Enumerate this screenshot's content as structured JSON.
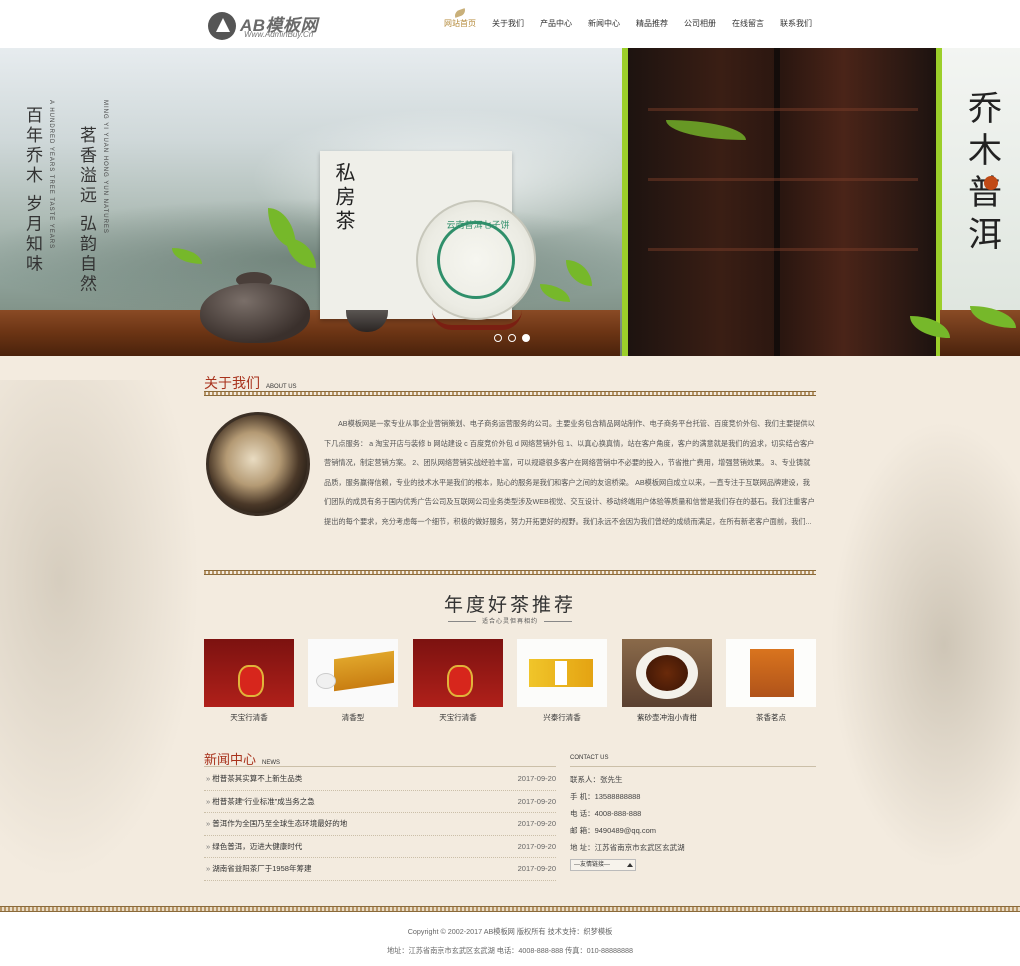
{
  "logo": {
    "text": "AB模板网",
    "sub": "Www.AdminBuy.Cn"
  },
  "nav": [
    "网站首页",
    "关于我们",
    "产品中心",
    "新闻中心",
    "精品推荐",
    "公司相册",
    "在线留言",
    "联系我们"
  ],
  "banner": {
    "vert1": "百年乔木 岁月知味",
    "vert2": "茗香溢远 弘韵自然",
    "en1": "A HUNDRED YEARS TREE TASTE YEARS",
    "en2": "MING YI YUAN HONG YUN NATURES",
    "card_title": "私房茶",
    "cake_label": "云南普洱七子饼",
    "right_title": "乔木普洱",
    "slides": 3,
    "active_slide": 3
  },
  "about": {
    "title": "关于我们",
    "en": "ABOUT US",
    "text": "AB模板网是一家专业从事企业营销策划、电子商务运营服务的公司。主要业务包含精品网站制作、电子商务平台托管、百度竞价外包、我们主要提供以下几点服务： a 淘宝开店与装修 b 网站建设 c 百度竞价外包 d 网络营销外包 1、以真心换真情，站在客户角度，客户的满意就是我们的追求，切实结合客户营销情况，制定营销方案。 2、团队网络营销实战经验丰富，可以规避很多客户在网络营销中不必要的投入，节省推广费用，增强营销效果。 3、专业铸就品质，服务赢得信赖，专业的技术水平是我们的根本，贴心的服务是我们和客户之间的友谊桥梁。 AB模板网自成立以来，一直专注于互联网品牌建设，我们团队的成员有务于国内优秀广告公司及互联网公司业务类型涉及WEB视觉、交互设计、移动终端用户体验等质量和信誉是我们存在的基石。我们注重客户提出的每个要求，充分考虑每一个细节，积极的做好服务，努力开拓更好的视野。我们永远不会因为我们曾经的成绩而满足，在所有新老客户面前，我们..."
  },
  "tea": {
    "title": "年度好茶推荐",
    "sub": "适合心灵但再相约",
    "products": [
      {
        "name": "天宝行清香",
        "style": "red"
      },
      {
        "name": "清香型",
        "style": "gold"
      },
      {
        "name": "天宝行清香",
        "style": "red"
      },
      {
        "name": "兴泰行清香",
        "style": "yellow"
      },
      {
        "name": "紫砂壶冲泡小青柑",
        "style": "cup"
      },
      {
        "name": "茶香茗点",
        "style": "box"
      }
    ]
  },
  "news": {
    "title": "新闻中心",
    "en": "NEWS",
    "items": [
      {
        "title": "柑普茶其实算不上新生品类",
        "date": "2017-09-20"
      },
      {
        "title": "柑普茶建“行业标准”成当务之急",
        "date": "2017-09-20"
      },
      {
        "title": "普洱作为全国乃至全球生态环境最好的地",
        "date": "2017-09-20"
      },
      {
        "title": "绿色普洱，迈进大健康时代",
        "date": "2017-09-20"
      },
      {
        "title": "湖南省益阳茶厂于1958年筹建",
        "date": "2017-09-20"
      }
    ]
  },
  "contact": {
    "title": "CONTACT US",
    "lines": [
      "联系人：张先生",
      "手 机：13588888888",
      "电 话：4008-888-888",
      "邮 箱：9490489@qq.com",
      "地 址：江苏省南京市玄武区玄武湖"
    ],
    "friend_links": "---友情链接---"
  },
  "footer": {
    "line1": "Copyright © 2002-2017 AB模板网 版权所有  技术支持：织梦模板",
    "line2": "地址：江苏省南京市玄武区玄武湖  电话：4008-888-888  传真：010-88888888"
  },
  "colors": {
    "accent": "#a8321c",
    "nav_active": "#b48a3a",
    "paper": "#f3ebdf",
    "leaf": "#76b82a"
  }
}
